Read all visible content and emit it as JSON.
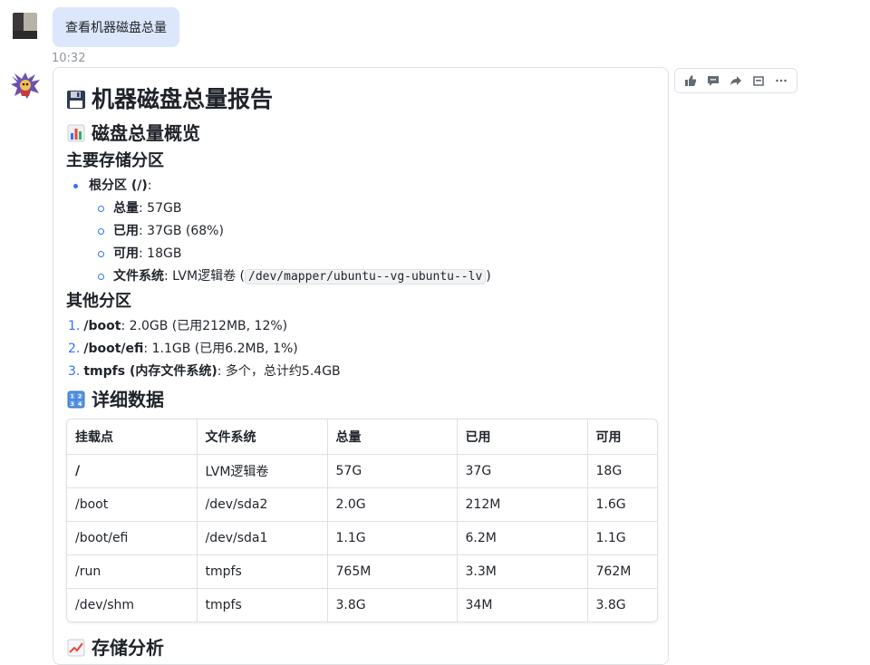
{
  "user_message": {
    "text": "查看机器磁盘总量",
    "time": "10:32"
  },
  "actions": [
    {
      "name": "thumbs-up-icon"
    },
    {
      "name": "comment-icon"
    },
    {
      "name": "share-icon"
    },
    {
      "name": "bookmark-icon"
    },
    {
      "name": "more-icon"
    }
  ],
  "report": {
    "title": "机器磁盘总量报告",
    "title_icon": "floppy-disk-icon",
    "overview_title": "磁盘总量概览",
    "overview_icon": "bar-chart-icon",
    "main_partitions_title": "主要存储分区",
    "root": {
      "label": "根分区 (/)",
      "colon": ":",
      "items": [
        {
          "key": "总量",
          "value": ": 57GB"
        },
        {
          "key": "已用",
          "value": ": 37GB (68%)"
        },
        {
          "key": "可用",
          "value": ": 18GB"
        },
        {
          "key": "文件系统",
          "value": ": LVM逻辑卷 (",
          "code": "/dev/mapper/ubuntu--vg-ubuntu--lv",
          "tail": ")"
        }
      ]
    },
    "other_title": "其他分区",
    "other_items": [
      {
        "num": "1.",
        "key": "/boot",
        "value": ": 2.0GB (已用212MB, 12%)"
      },
      {
        "num": "2.",
        "key": "/boot/efi",
        "value": ": 1.1GB (已用6.2MB, 1%)"
      },
      {
        "num": "3.",
        "key": "tmpfs (内存文件系统)",
        "value": ": 多个，总计约5.4GB"
      }
    ],
    "detail_title": "详细数据",
    "detail_icon": "numbers-icon",
    "table": {
      "headers": [
        "挂载点",
        "文件系统",
        "总量",
        "已用",
        "可用"
      ],
      "rows": [
        [
          "/",
          "LVM逻辑卷",
          "57G",
          "37G",
          "18G"
        ],
        [
          "/boot",
          "/dev/sda2",
          "2.0G",
          "212M",
          "1.6G"
        ],
        [
          "/boot/efi",
          "/dev/sda1",
          "1.1G",
          "6.2M",
          "1.1G"
        ],
        [
          "/run",
          "tmpfs",
          "765M",
          "3.3M",
          "762M"
        ],
        [
          "/dev/shm",
          "tmpfs",
          "3.8G",
          "34M",
          "3.8G"
        ]
      ]
    },
    "analysis_title": "存储分析",
    "analysis_icon": "trend-chart-icon"
  },
  "colors": {
    "accent": "#3370ff",
    "bubble": "#dce7fb",
    "border": "#dee0e3"
  }
}
